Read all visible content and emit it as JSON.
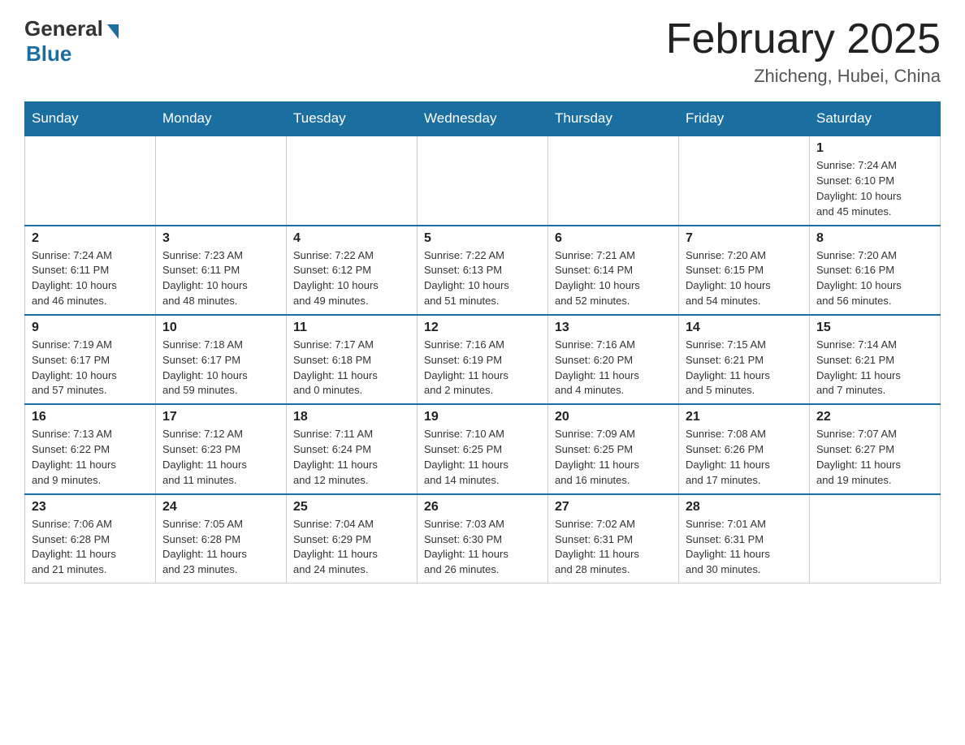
{
  "header": {
    "logo_general": "General",
    "logo_blue": "Blue",
    "month_title": "February 2025",
    "location": "Zhicheng, Hubei, China"
  },
  "weekdays": [
    "Sunday",
    "Monday",
    "Tuesday",
    "Wednesday",
    "Thursday",
    "Friday",
    "Saturday"
  ],
  "weeks": [
    [
      {
        "day": "",
        "info": ""
      },
      {
        "day": "",
        "info": ""
      },
      {
        "day": "",
        "info": ""
      },
      {
        "day": "",
        "info": ""
      },
      {
        "day": "",
        "info": ""
      },
      {
        "day": "",
        "info": ""
      },
      {
        "day": "1",
        "info": "Sunrise: 7:24 AM\nSunset: 6:10 PM\nDaylight: 10 hours\nand 45 minutes."
      }
    ],
    [
      {
        "day": "2",
        "info": "Sunrise: 7:24 AM\nSunset: 6:11 PM\nDaylight: 10 hours\nand 46 minutes."
      },
      {
        "day": "3",
        "info": "Sunrise: 7:23 AM\nSunset: 6:11 PM\nDaylight: 10 hours\nand 48 minutes."
      },
      {
        "day": "4",
        "info": "Sunrise: 7:22 AM\nSunset: 6:12 PM\nDaylight: 10 hours\nand 49 minutes."
      },
      {
        "day": "5",
        "info": "Sunrise: 7:22 AM\nSunset: 6:13 PM\nDaylight: 10 hours\nand 51 minutes."
      },
      {
        "day": "6",
        "info": "Sunrise: 7:21 AM\nSunset: 6:14 PM\nDaylight: 10 hours\nand 52 minutes."
      },
      {
        "day": "7",
        "info": "Sunrise: 7:20 AM\nSunset: 6:15 PM\nDaylight: 10 hours\nand 54 minutes."
      },
      {
        "day": "8",
        "info": "Sunrise: 7:20 AM\nSunset: 6:16 PM\nDaylight: 10 hours\nand 56 minutes."
      }
    ],
    [
      {
        "day": "9",
        "info": "Sunrise: 7:19 AM\nSunset: 6:17 PM\nDaylight: 10 hours\nand 57 minutes."
      },
      {
        "day": "10",
        "info": "Sunrise: 7:18 AM\nSunset: 6:17 PM\nDaylight: 10 hours\nand 59 minutes."
      },
      {
        "day": "11",
        "info": "Sunrise: 7:17 AM\nSunset: 6:18 PM\nDaylight: 11 hours\nand 0 minutes."
      },
      {
        "day": "12",
        "info": "Sunrise: 7:16 AM\nSunset: 6:19 PM\nDaylight: 11 hours\nand 2 minutes."
      },
      {
        "day": "13",
        "info": "Sunrise: 7:16 AM\nSunset: 6:20 PM\nDaylight: 11 hours\nand 4 minutes."
      },
      {
        "day": "14",
        "info": "Sunrise: 7:15 AM\nSunset: 6:21 PM\nDaylight: 11 hours\nand 5 minutes."
      },
      {
        "day": "15",
        "info": "Sunrise: 7:14 AM\nSunset: 6:21 PM\nDaylight: 11 hours\nand 7 minutes."
      }
    ],
    [
      {
        "day": "16",
        "info": "Sunrise: 7:13 AM\nSunset: 6:22 PM\nDaylight: 11 hours\nand 9 minutes."
      },
      {
        "day": "17",
        "info": "Sunrise: 7:12 AM\nSunset: 6:23 PM\nDaylight: 11 hours\nand 11 minutes."
      },
      {
        "day": "18",
        "info": "Sunrise: 7:11 AM\nSunset: 6:24 PM\nDaylight: 11 hours\nand 12 minutes."
      },
      {
        "day": "19",
        "info": "Sunrise: 7:10 AM\nSunset: 6:25 PM\nDaylight: 11 hours\nand 14 minutes."
      },
      {
        "day": "20",
        "info": "Sunrise: 7:09 AM\nSunset: 6:25 PM\nDaylight: 11 hours\nand 16 minutes."
      },
      {
        "day": "21",
        "info": "Sunrise: 7:08 AM\nSunset: 6:26 PM\nDaylight: 11 hours\nand 17 minutes."
      },
      {
        "day": "22",
        "info": "Sunrise: 7:07 AM\nSunset: 6:27 PM\nDaylight: 11 hours\nand 19 minutes."
      }
    ],
    [
      {
        "day": "23",
        "info": "Sunrise: 7:06 AM\nSunset: 6:28 PM\nDaylight: 11 hours\nand 21 minutes."
      },
      {
        "day": "24",
        "info": "Sunrise: 7:05 AM\nSunset: 6:28 PM\nDaylight: 11 hours\nand 23 minutes."
      },
      {
        "day": "25",
        "info": "Sunrise: 7:04 AM\nSunset: 6:29 PM\nDaylight: 11 hours\nand 24 minutes."
      },
      {
        "day": "26",
        "info": "Sunrise: 7:03 AM\nSunset: 6:30 PM\nDaylight: 11 hours\nand 26 minutes."
      },
      {
        "day": "27",
        "info": "Sunrise: 7:02 AM\nSunset: 6:31 PM\nDaylight: 11 hours\nand 28 minutes."
      },
      {
        "day": "28",
        "info": "Sunrise: 7:01 AM\nSunset: 6:31 PM\nDaylight: 11 hours\nand 30 minutes."
      },
      {
        "day": "",
        "info": ""
      }
    ]
  ]
}
